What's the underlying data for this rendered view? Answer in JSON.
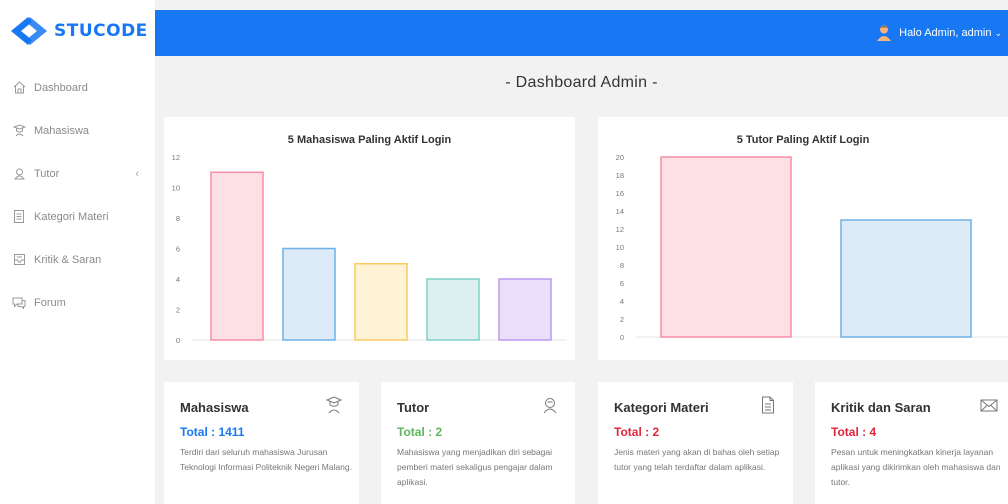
{
  "brand": {
    "name": "STUCODE"
  },
  "sidebar": {
    "items": [
      {
        "label": "Dashboard",
        "icon": "home-icon"
      },
      {
        "label": "Mahasiswa",
        "icon": "student-icon"
      },
      {
        "label": "Tutor",
        "icon": "tutor-icon",
        "has_submenu": true
      },
      {
        "label": "Kategori Materi",
        "icon": "document-icon"
      },
      {
        "label": "Kritik & Saran",
        "icon": "inbox-icon"
      },
      {
        "label": "Forum",
        "icon": "forum-icon"
      }
    ]
  },
  "header": {
    "user_label": "Halo Admin, admin",
    "accent": "#1877f2"
  },
  "page": {
    "title": "- Dashboard Admin -"
  },
  "chart_data": [
    {
      "type": "bar",
      "title": "5 Mahasiswa Paling Aktif Login",
      "categories": [
        "",
        "",
        "",
        "",
        ""
      ],
      "values": [
        11,
        6,
        5,
        4,
        4
      ],
      "ylim": [
        0,
        12
      ],
      "yticks": [
        0,
        2,
        4,
        6,
        8,
        10,
        12
      ],
      "fills": [
        "#fde0e6",
        "#dcebf7",
        "#fff3d6",
        "#dcf1ef",
        "#ebe0fb"
      ],
      "strokes": [
        "#f58fa5",
        "#6db2e6",
        "#fcc864",
        "#7fcfc9",
        "#b998f2"
      ],
      "grid": false
    },
    {
      "type": "bar",
      "title": "5 Tutor Paling Aktif Login",
      "categories": [
        "",
        ""
      ],
      "values": [
        20,
        13
      ],
      "ylim": [
        0,
        20
      ],
      "yticks": [
        0,
        2,
        4,
        6,
        8,
        10,
        12,
        14,
        16,
        18,
        20
      ],
      "fills": [
        "#fde0e6",
        "#dcebf7"
      ],
      "strokes": [
        "#f58fa5",
        "#6db2e6"
      ],
      "grid": false
    }
  ],
  "stats": [
    {
      "title": "Mahasiswa",
      "total": "Total : 1411",
      "color": "#1877f2",
      "icon": "student-icon",
      "desc": "Terdiri dari seluruh mahasiswa Jurusan Teknologi Informasi Politeknik Negeri Malang."
    },
    {
      "title": "Tutor",
      "total": "Total : 2",
      "color": "#5cb85c",
      "icon": "tutor-icon",
      "desc": "Mahasiswa yang menjadikan diri sebagai pemberi materi sekaligus pengajar dalam aplikasi."
    },
    {
      "title": "Kategori Materi",
      "total": "Total : 2",
      "color": "#e0263b",
      "icon": "document-icon",
      "desc": "Jenis materi yang akan di bahas oleh setiap tutor yang telah terdaftar dalam aplikasi."
    },
    {
      "title": "Kritik dan Saran",
      "total": "Total : 4",
      "color": "#e0263b",
      "icon": "mail-icon",
      "desc": "Pesan untuk meningkatkan kinerja layanan aplikasi yang dikirimkan oleh mahasiswa dan tutor."
    }
  ]
}
